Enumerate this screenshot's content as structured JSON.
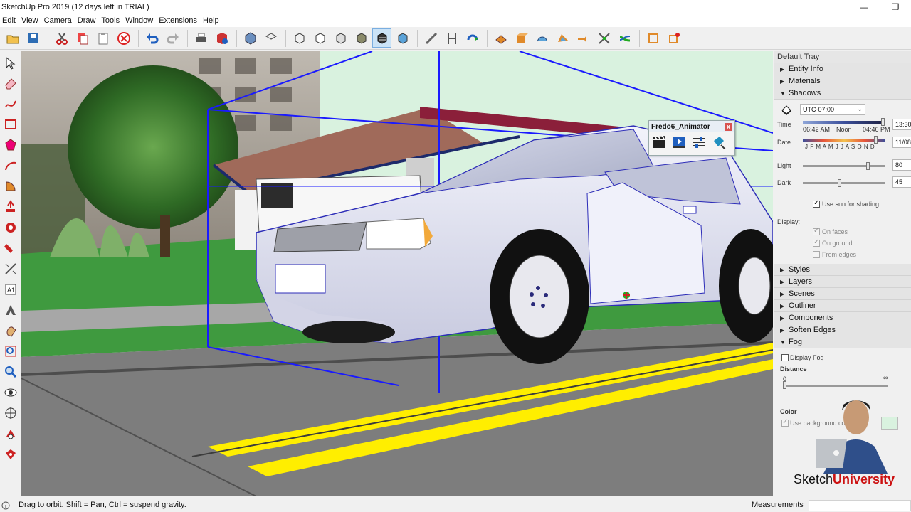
{
  "window": {
    "title": "SketchUp Pro 2019 (12 days left in TRIAL)",
    "minimize": "—",
    "restore": "❐"
  },
  "menu": [
    "Edit",
    "View",
    "Camera",
    "Draw",
    "Tools",
    "Window",
    "Extensions",
    "Help"
  ],
  "animator": {
    "title": "Fredo6_Animator",
    "close": "x"
  },
  "tray": {
    "title": "Default Tray",
    "panels_top": [
      {
        "label": "Entity Info",
        "expanded": false
      },
      {
        "label": "Materials",
        "expanded": false
      },
      {
        "label": "Shadows",
        "expanded": true
      }
    ],
    "shadows": {
      "timezone": "UTC-07:00",
      "time_label": "Time",
      "time_start": "06:42 AM",
      "time_noon": "Noon",
      "time_end": "04:46 PM",
      "time_value": "13:30",
      "date_label": "Date",
      "months": "J F M A M J J A S O N D",
      "date_value": "11/08",
      "light_label": "Light",
      "light_value": "80",
      "light_level": 0.8,
      "dark_label": "Dark",
      "dark_value": "45",
      "dark_level": 0.45,
      "use_sun_label": "Use sun for shading",
      "use_sun_checked": true,
      "display_label": "Display:",
      "on_faces": "On faces",
      "on_ground": "On ground",
      "from_edges": "From edges"
    },
    "panels_mid": [
      {
        "label": "Styles",
        "expanded": false
      },
      {
        "label": "Layers",
        "expanded": false
      },
      {
        "label": "Scenes",
        "expanded": false
      },
      {
        "label": "Outliner",
        "expanded": false
      },
      {
        "label": "Components",
        "expanded": false
      },
      {
        "label": "Soften Edges",
        "expanded": false
      },
      {
        "label": "Fog",
        "expanded": true
      }
    ],
    "fog": {
      "display_fog_label": "Display Fog",
      "display_fog_checked": false,
      "distance_label": "Distance",
      "dist_start": "0",
      "dist_end": "∞",
      "color_label": "Color",
      "use_bg_label": "Use background co"
    }
  },
  "statusbar": {
    "hint": "Drag to orbit. Shift = Pan, Ctrl = suspend gravity.",
    "measurements_label": "Measurements"
  },
  "brand": {
    "part1": "Sketch",
    "part2": "University"
  },
  "colors": {
    "sky": "#d9f2df",
    "road": "#7d7d7d",
    "grass": "#3f9a3f",
    "lane": "#ffee00",
    "selection": "#1a1aff",
    "car": "#e9eaf6"
  }
}
